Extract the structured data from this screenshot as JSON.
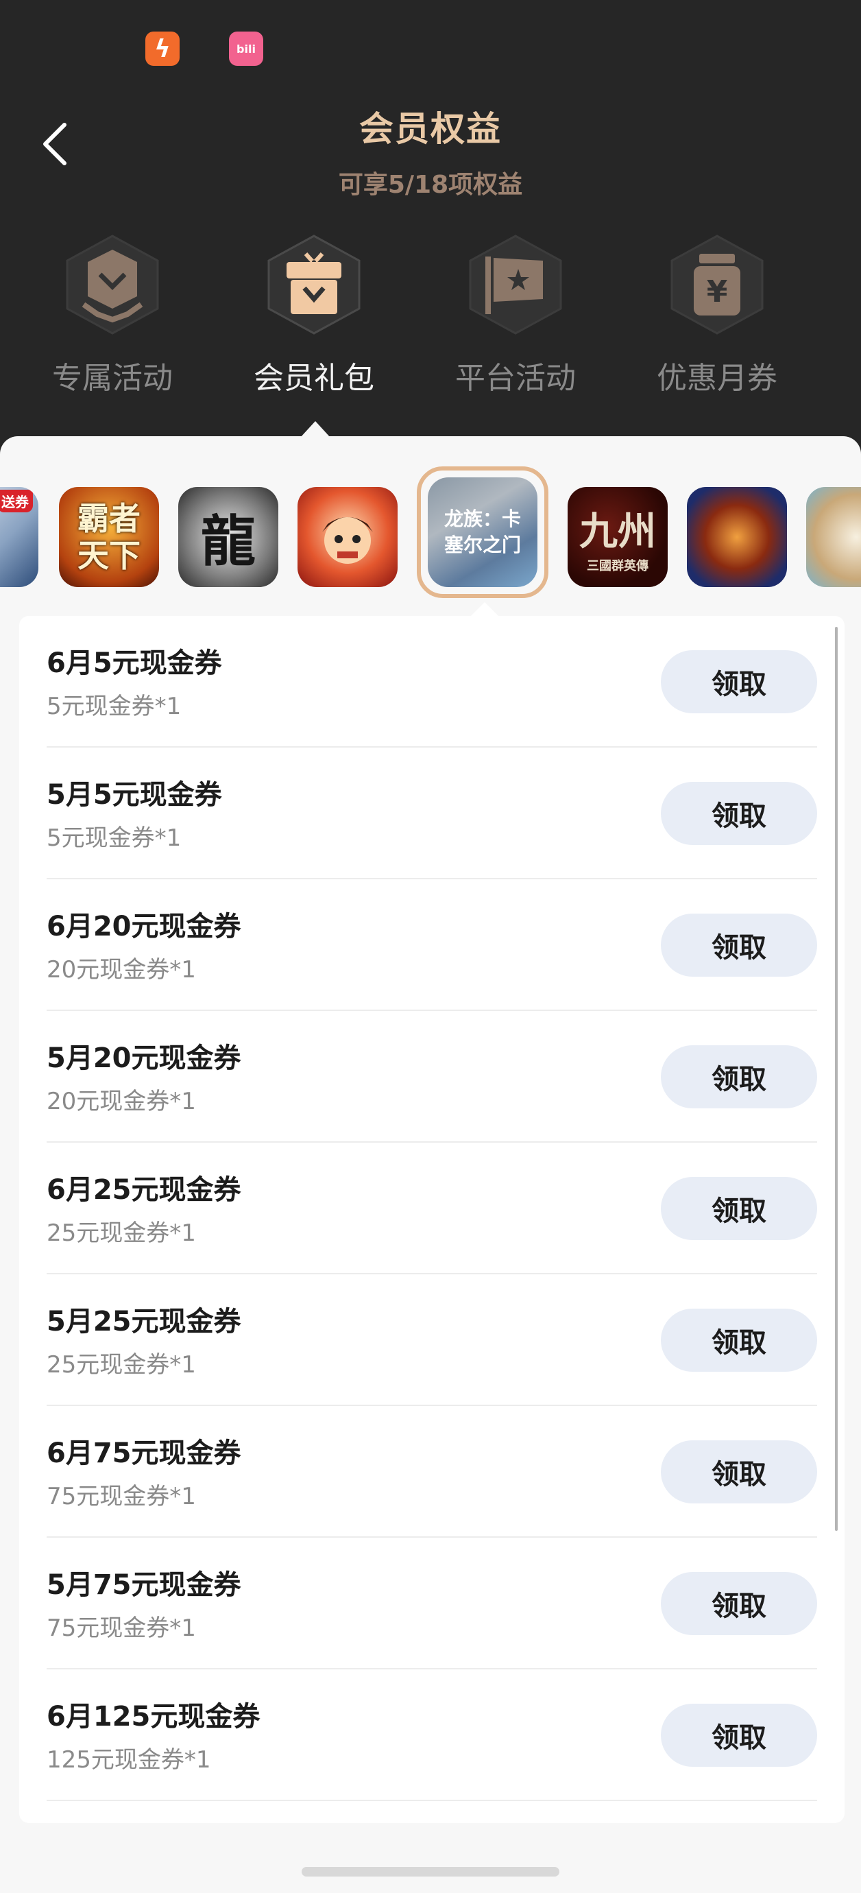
{
  "status_bar": {
    "apps": [
      {
        "name": "app-icon-orange",
        "glyph": "ϟ",
        "color": "#f26b2b"
      },
      {
        "name": "bilibili-icon",
        "glyph": "bili",
        "color": "#f2628f"
      }
    ]
  },
  "header": {
    "title": "会员权益",
    "subtitle": "可享5/18项权益"
  },
  "tabs": [
    {
      "label": "专属活动",
      "icon": "badge-icon"
    },
    {
      "label": "会员礼包",
      "icon": "gift-icon",
      "active": true
    },
    {
      "label": "平台活动",
      "icon": "flag-icon"
    },
    {
      "label": "优惠月券",
      "icon": "coupon-yen-icon"
    }
  ],
  "games": {
    "first_badge": "送券",
    "selected_label_line1": "龙族：卡",
    "selected_label_line2": "塞尔之门",
    "glyphs": {
      "g1": "霸者天下",
      "g2": "龍",
      "g3": "",
      "g5": "九州",
      "g5_sub": "三國群英傳"
    }
  },
  "items": [
    {
      "name": "6月5元现金券",
      "desc": "5元现金券*1",
      "button": "领取"
    },
    {
      "name": "5月5元现金券",
      "desc": "5元现金券*1",
      "button": "领取"
    },
    {
      "name": "6月20元现金券",
      "desc": "20元现金券*1",
      "button": "领取"
    },
    {
      "name": "5月20元现金券",
      "desc": "20元现金券*1",
      "button": "领取"
    },
    {
      "name": "6月25元现金券",
      "desc": "25元现金券*1",
      "button": "领取"
    },
    {
      "name": "5月25元现金券",
      "desc": "25元现金券*1",
      "button": "领取"
    },
    {
      "name": "6月75元现金券",
      "desc": "75元现金券*1",
      "button": "领取"
    },
    {
      "name": "5月75元现金券",
      "desc": "75元现金券*1",
      "button": "领取"
    },
    {
      "name": "6月125元现金券",
      "desc": "125元现金券*1",
      "button": "领取"
    }
  ],
  "colors": {
    "header_bg": "#262626",
    "accent_gold": "#e9c9a6",
    "button_bg": "#e8edf6"
  }
}
